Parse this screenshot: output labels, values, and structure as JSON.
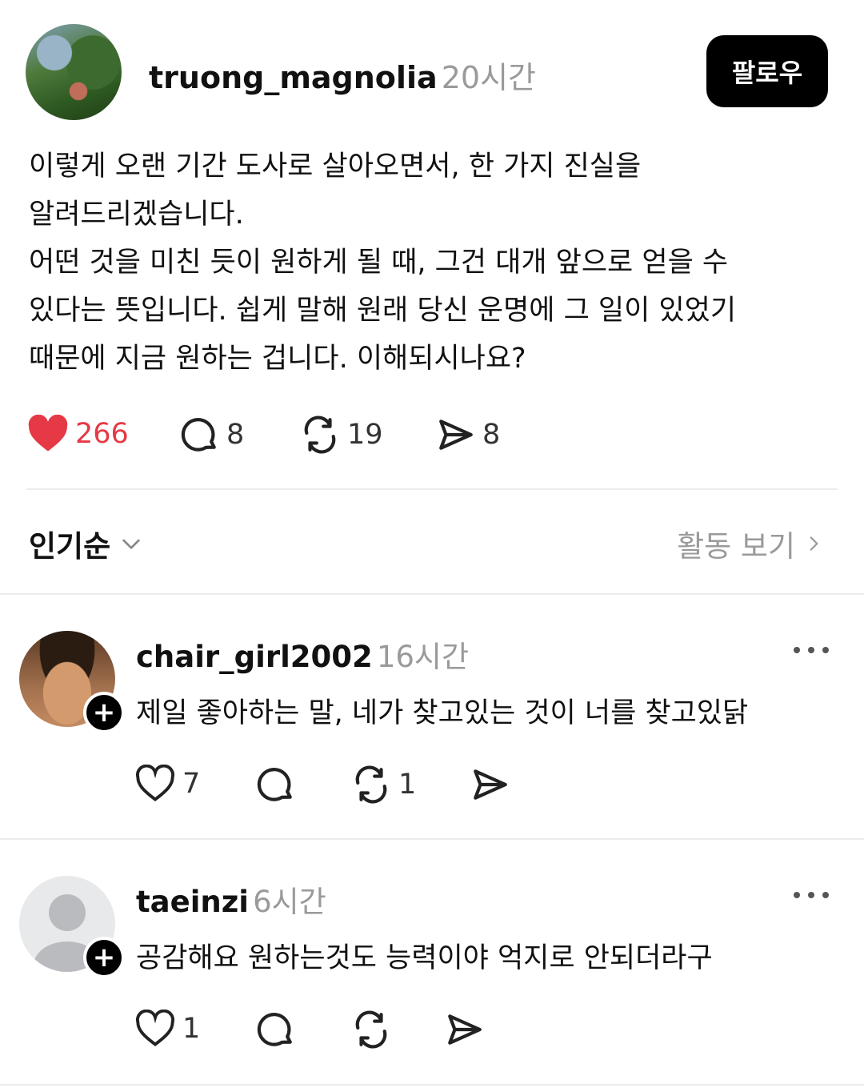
{
  "post": {
    "username": "truong_magnolia",
    "time": "20시간",
    "follow_label": "팔로우",
    "lines": [
      "이렇게 오랜 기간 도사로 살아오면서, 한 가지 진실을",
      "알려드리겠습니다.",
      "어떤 것을 미친 듯이 원하게 될 때, 그건 대개 앞으로 얻을 수",
      "있다는 뜻입니다. 쉽게 말해 원래 당신 운명에 그 일이 있었기",
      "때문에 지금 원하는 겁니다. 이해되시나요?"
    ],
    "likes": "266",
    "replies": "8",
    "reposts": "19",
    "shares": "8",
    "like_color": "#e63946"
  },
  "sort": {
    "label": "인기순",
    "activity_label": "활동 보기"
  },
  "comments": [
    {
      "username": "chair_girl2002",
      "time": "16시간",
      "text": "제일 좋아하는 말, 네가 찾고있는 것이 너를 찾고있닭",
      "likes": "7",
      "reposts": "1"
    },
    {
      "username": "taeinzi",
      "time": "6시간",
      "text": "공감해요 원하는것도 능력이야 억지로 안되더라구",
      "likes": "1"
    }
  ],
  "icons": [
    "heart-icon",
    "comment-icon",
    "repost-icon",
    "share-icon",
    "chevron-down-icon",
    "chevron-right-icon",
    "more-icon",
    "plus-icon"
  ]
}
